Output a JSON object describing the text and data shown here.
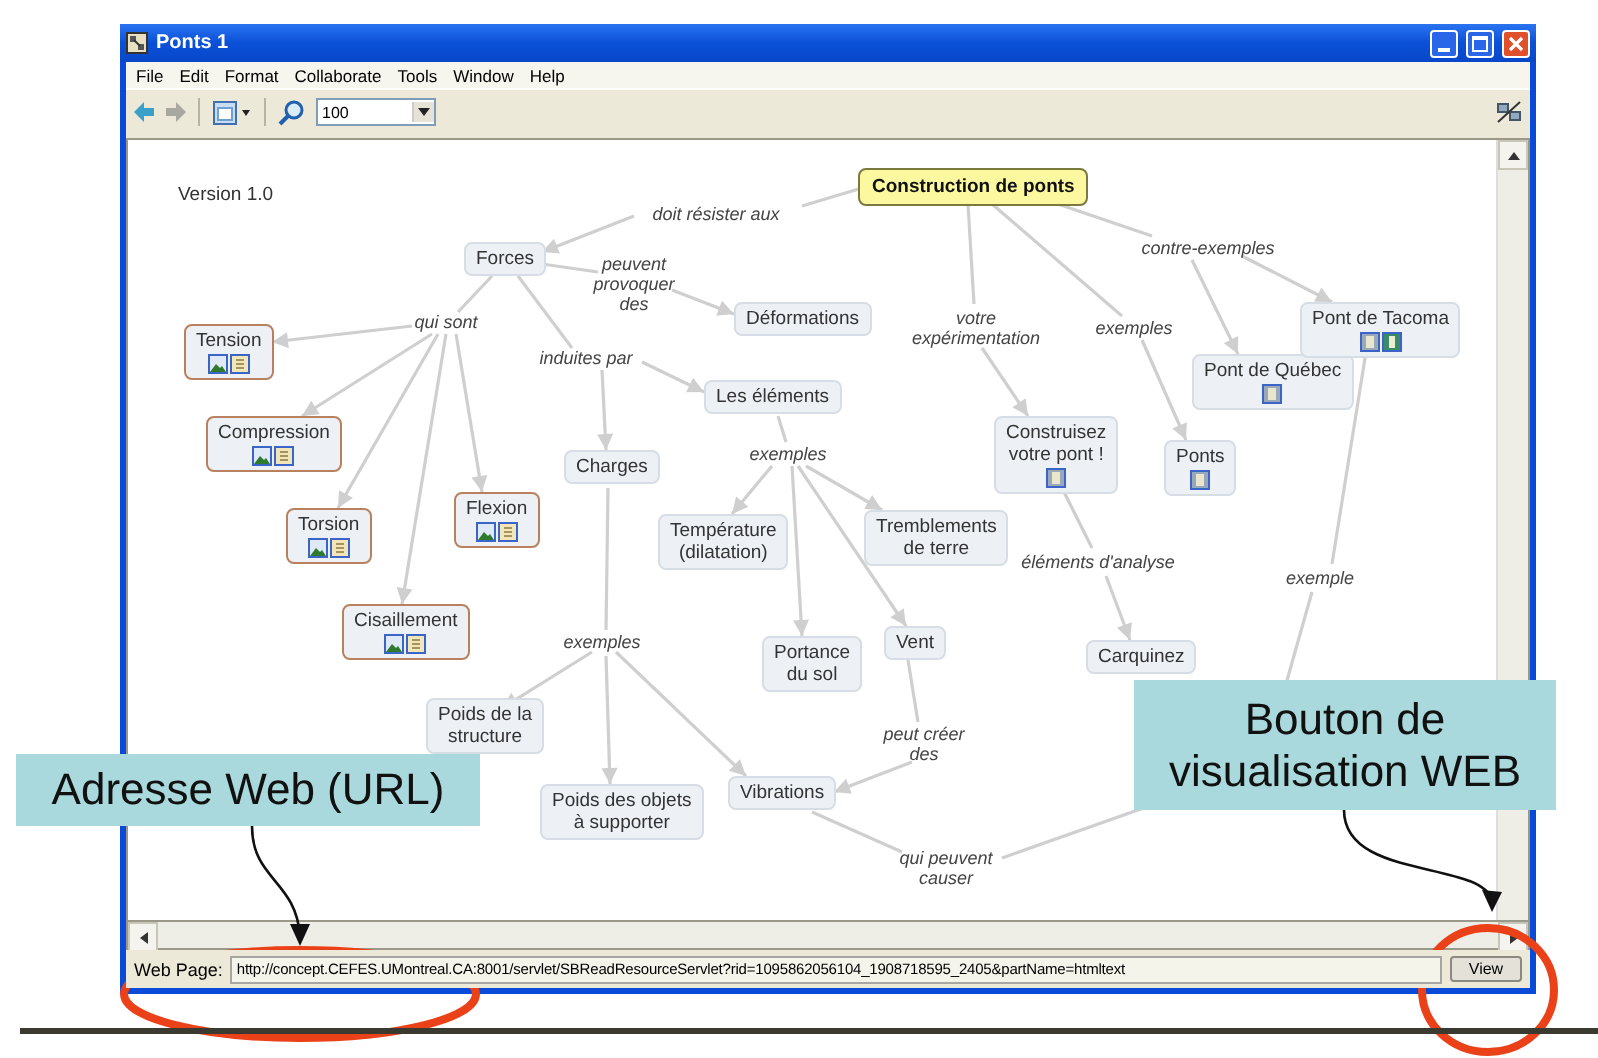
{
  "window": {
    "title": "Ponts 1"
  },
  "menu": [
    {
      "label": "File"
    },
    {
      "label": "Edit"
    },
    {
      "label": "Format"
    },
    {
      "label": "Collaborate"
    },
    {
      "label": "Tools"
    },
    {
      "label": "Window"
    },
    {
      "label": "Help"
    }
  ],
  "toolbar": {
    "zoom": "100"
  },
  "map": {
    "version": "Version 1.0",
    "concepts": [
      {
        "label": "Construction de ponts",
        "kind": "root"
      },
      {
        "label": "Forces",
        "kind": "plain"
      },
      {
        "label": "Déformations",
        "kind": "plain"
      },
      {
        "label": "Tension",
        "kind": "outlined",
        "image": true,
        "document": true
      },
      {
        "label": "Compression",
        "kind": "outlined",
        "image": true,
        "document": true
      },
      {
        "label": "Torsion",
        "kind": "outlined",
        "image": true,
        "document": true
      },
      {
        "label": "Flexion",
        "kind": "outlined",
        "image": true,
        "document": true
      },
      {
        "label": "Cisaillement",
        "kind": "outlined",
        "image": true,
        "document": true
      },
      {
        "label": "Charges",
        "kind": "plain"
      },
      {
        "label": "Les éléments",
        "kind": "plain"
      },
      {
        "label": "Température\n(dilatation)",
        "kind": "plain"
      },
      {
        "label": "Tremblements\nde terre",
        "kind": "plain"
      },
      {
        "label": "Portance\ndu sol",
        "kind": "plain"
      },
      {
        "label": "Vent",
        "kind": "plain"
      },
      {
        "label": "Poids de la\nstructure",
        "kind": "plain"
      },
      {
        "label": "Poids des objets\nà supporter",
        "kind": "plain"
      },
      {
        "label": "Vibrations",
        "kind": "plain"
      },
      {
        "label": "Construisez\nvotre pont !",
        "kind": "plain",
        "web_link": true
      },
      {
        "label": "Ponts",
        "kind": "plain",
        "web_link": true
      },
      {
        "label": "Pont de Québec",
        "kind": "plain",
        "web_link": true
      },
      {
        "label": "Pont de Tacoma",
        "kind": "plain",
        "web_link": true,
        "media": true
      },
      {
        "label": "Carquinez",
        "kind": "plain"
      }
    ],
    "links": [
      {
        "label": "doit résister aux"
      },
      {
        "label": "peuvent\nprovoquer\ndes"
      },
      {
        "label": "qui sont"
      },
      {
        "label": "induites par"
      },
      {
        "label": "exemples"
      },
      {
        "label": "exemples"
      },
      {
        "label": "votre\nexpérimentation"
      },
      {
        "label": "exemples"
      },
      {
        "label": "contre-exemples"
      },
      {
        "label": "éléments d'analyse"
      },
      {
        "label": "exemple"
      },
      {
        "label": "peut créer\ndes"
      },
      {
        "label": "qui peuvent\ncauser"
      }
    ]
  },
  "web_page_bar": {
    "label": "Web Page:",
    "url": "http://concept.CEFES.UMontreal.CA:8001/servlet/SBReadResourceServlet?rid=1095862056104_1908718595_2405&partName=htmltext",
    "button": "View"
  },
  "callouts": [
    {
      "text": "Adresse Web (URL)"
    },
    {
      "text": "Bouton de visualisation WEB"
    }
  ]
}
